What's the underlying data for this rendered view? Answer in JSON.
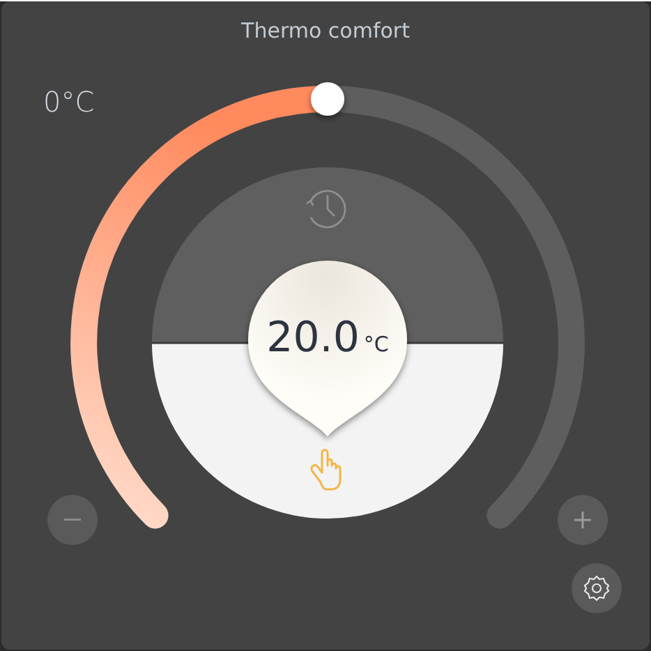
{
  "title": "Thermo comfort",
  "min_label": "0°C",
  "setpoint": {
    "value": "20.0",
    "unit": "°C"
  }
}
